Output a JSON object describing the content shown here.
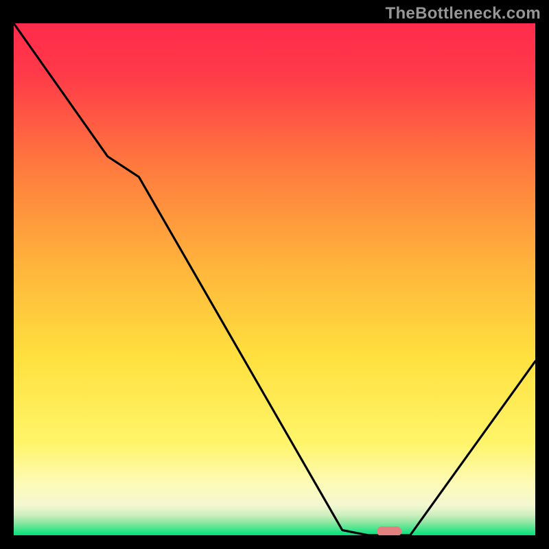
{
  "watermark": "TheBottleneck.com",
  "colors": {
    "frame": "#000000",
    "grad_top": "#FF2B4C",
    "grad_mid_upper": "#FF8A3C",
    "grad_mid": "#FFD23F",
    "grad_lower": "#FFF58A",
    "grad_cream": "#FCFBD0",
    "grad_green": "#00E27A",
    "line": "#000000",
    "marker": "#E2817F"
  },
  "chart_data": {
    "type": "line",
    "title": "",
    "xlabel": "",
    "ylabel": "",
    "xlim": [
      0,
      100
    ],
    "ylim": [
      0,
      100
    ],
    "x": [
      0,
      18,
      24,
      63,
      68,
      76,
      100
    ],
    "values": [
      100,
      74,
      70,
      1,
      0,
      0,
      34
    ],
    "marker": {
      "x": 72,
      "y": 0.5,
      "shape": "pill"
    },
    "notes": "V-shaped bottleneck curve over a vertical red→yellow→green gradient; minimum around x≈68–76. No visible axis ticks or labels."
  }
}
